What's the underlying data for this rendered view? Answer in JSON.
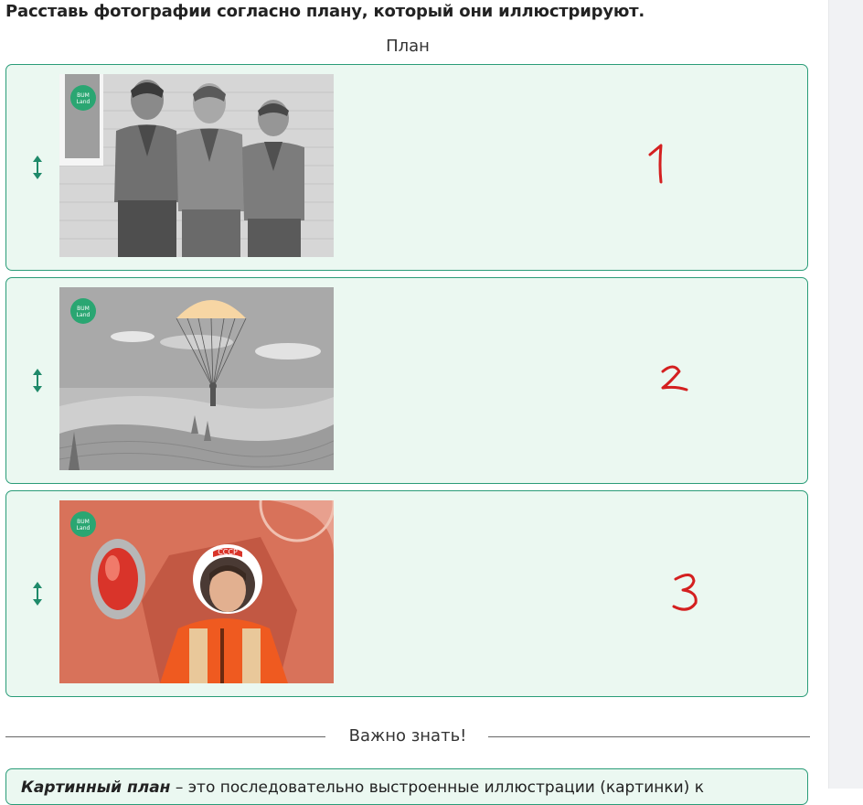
{
  "instruction": "Расставь фотографии согласно плану, который они иллюстрируют.",
  "plan_heading": "План",
  "cards": [
    {
      "image": "pioneers-illustration",
      "number": "1"
    },
    {
      "image": "parachute-illustration",
      "number": "2"
    },
    {
      "image": "cosmonaut-illustration",
      "number": "3"
    }
  ],
  "logo_text": [
    "BUM",
    "Land"
  ],
  "divider_label": "Важно знать!",
  "info": {
    "lead": "Картинный план",
    "text": " – это последовательно выстроенные иллюстрации (картинки) к"
  },
  "colors": {
    "card_bg": "#ebf8f1",
    "card_border": "#2a9c78",
    "handle": "#1f8a6a",
    "handwriting": "#d42020",
    "logo": "#2aa672"
  },
  "icons": [
    "drag-handle-icon"
  ]
}
